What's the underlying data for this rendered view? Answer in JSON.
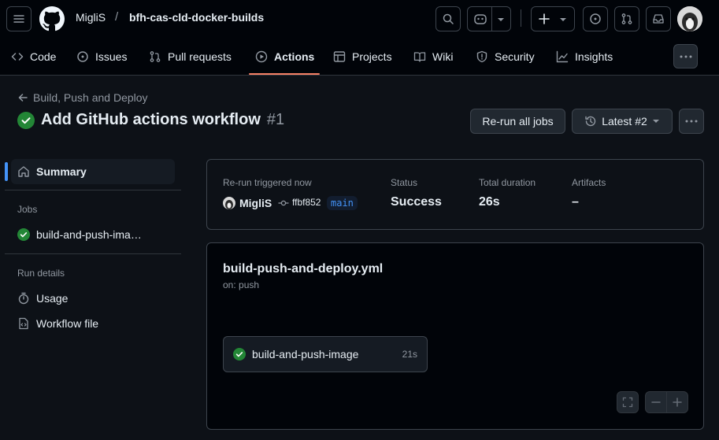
{
  "header": {
    "owner": "MigliS",
    "separator": "/",
    "repo": "bfh-cas-cld-docker-builds"
  },
  "tabs": [
    {
      "label": "Code",
      "icon": "code-icon"
    },
    {
      "label": "Issues",
      "icon": "issue-icon"
    },
    {
      "label": "Pull requests",
      "icon": "pull-request-icon"
    },
    {
      "label": "Actions",
      "icon": "play-icon",
      "active": true
    },
    {
      "label": "Projects",
      "icon": "table-icon"
    },
    {
      "label": "Wiki",
      "icon": "book-icon"
    },
    {
      "label": "Security",
      "icon": "shield-icon"
    },
    {
      "label": "Insights",
      "icon": "graph-icon"
    }
  ],
  "run": {
    "back_label": "Build, Push and Deploy",
    "title": "Add GitHub actions workflow",
    "number": "#1",
    "rerun_label": "Re-run all jobs",
    "attempt_label": "Latest #2"
  },
  "sidebar": {
    "summary_label": "Summary",
    "jobs_heading": "Jobs",
    "job_label": "build-and-push-ima…",
    "run_details_heading": "Run details",
    "usage_label": "Usage",
    "workflow_file_label": "Workflow file"
  },
  "summary": {
    "trigger_label": "Re-run triggered now",
    "actor": "MigliS",
    "commit": "ffbf852",
    "branch": "main",
    "status_label": "Status",
    "status_value": "Success",
    "duration_label": "Total duration",
    "duration_value": "26s",
    "artifacts_label": "Artifacts",
    "artifacts_value": "–"
  },
  "workflow": {
    "file": "build-push-and-deploy.yml",
    "trigger": "on: push",
    "job_name": "build-and-push-image",
    "job_duration": "21s"
  },
  "colors": {
    "success": "#238636",
    "accent": "#f78166",
    "link": "#4493f8"
  }
}
